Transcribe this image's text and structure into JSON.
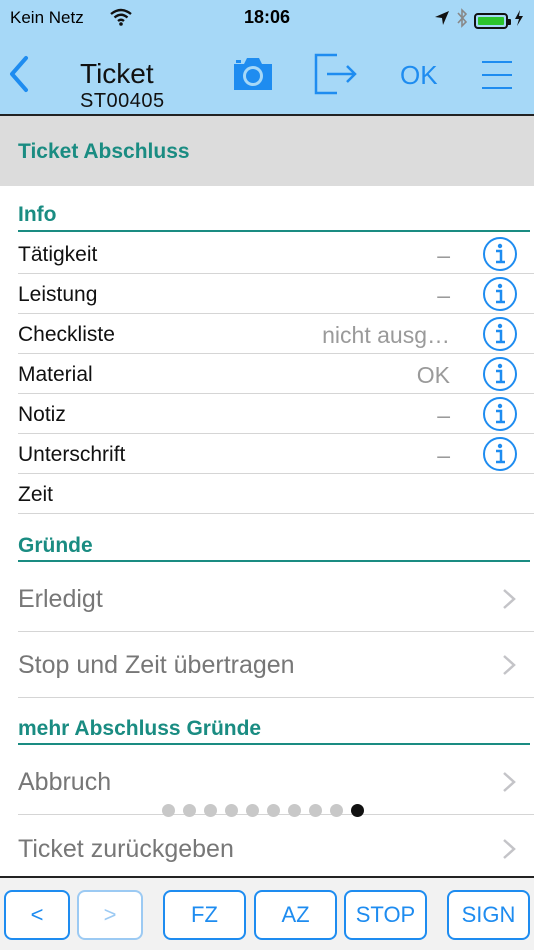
{
  "status_bar": {
    "carrier": "Kein Netz",
    "time": "18:06"
  },
  "nav": {
    "title": "Ticket",
    "subtitle": "ST00405",
    "ok_label": "OK"
  },
  "header": {
    "title": "Ticket Abschluss"
  },
  "info": {
    "title": "Info",
    "rows": [
      {
        "label": "Tätigkeit",
        "value": "–"
      },
      {
        "label": "Leistung",
        "value": "–"
      },
      {
        "label": "Checkliste",
        "value": "nicht ausg…"
      },
      {
        "label": "Material",
        "value": "OK"
      },
      {
        "label": "Notiz",
        "value": "–"
      },
      {
        "label": "Unterschrift",
        "value": "–"
      },
      {
        "label": "Zeit",
        "value": ""
      }
    ]
  },
  "reasons": {
    "title": "Gründe",
    "items": [
      {
        "label": "Erledigt"
      },
      {
        "label": "Stop und Zeit übertragen"
      }
    ]
  },
  "more_reasons": {
    "title": "mehr Abschluss Gründe",
    "items": [
      {
        "label": "Abbruch"
      },
      {
        "label": "Ticket zurückgeben"
      }
    ]
  },
  "page_indicator": {
    "count": 10,
    "active_index": 9
  },
  "toolbar": {
    "prev": "<",
    "next": ">",
    "fz": "FZ",
    "az": "AZ",
    "stop": "STOP",
    "sign": "SIGN"
  },
  "colors": {
    "nav_bg": "#a6d8f7",
    "accent": "#1e8cf0",
    "teal": "#1a8c82",
    "grey_header": "#dcdcdc"
  }
}
